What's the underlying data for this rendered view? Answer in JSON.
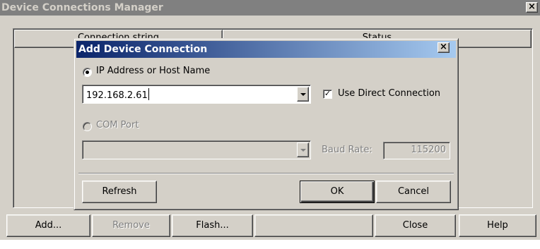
{
  "outer_window": {
    "title": "Device Connections Manager",
    "close_glyph": "×",
    "columns": [
      "Connection string",
      "Status"
    ],
    "buttons": {
      "add": "Add...",
      "remove": "Remove",
      "flash": "Flash...",
      "close": "Close",
      "help": "Help"
    }
  },
  "dialog": {
    "title": "Add Device Connection",
    "close_glyph": "×",
    "ip_option_label": "IP Address or Host Name",
    "ip_value": "192.168.2.61",
    "use_direct_connection_label": "Use Direct Connection",
    "use_direct_connection_checked": true,
    "checkmark": "✓",
    "com_option_label": "COM Port",
    "com_value": "",
    "baud_rate_label": "Baud Rate:",
    "baud_rate_value": "115200",
    "buttons": {
      "refresh": "Refresh",
      "ok": "OK",
      "cancel": "Cancel"
    }
  },
  "colors": {
    "dialog_title_bg": "#0a246a",
    "inactive_title_bg": "#808080",
    "face": "#d4d0c8"
  },
  "icons": {
    "close": "close-icon",
    "dropdown": "chevron-down-icon"
  }
}
